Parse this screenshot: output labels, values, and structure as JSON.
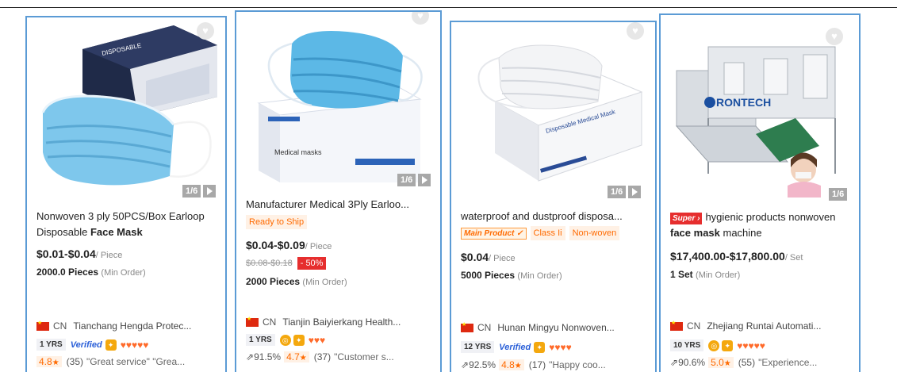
{
  "products": [
    {
      "title_pre": "Nonwoven 3 ply 50PCS/Box Earloop Disposable ",
      "title_bold": "Face Mask",
      "image_counter": "1/6",
      "price": "$0.01-$0.04",
      "unit": "/ Piece",
      "moq": "2000.0 Pieces",
      "min_order": "(Min Order)",
      "country": "CN",
      "supplier": "Tianchang Hengda Protec...",
      "years": "1 YRS",
      "verified": "Verified",
      "score": "4.8",
      "reviews": "(35)",
      "review_text": "\"Great service\"  \"Grea..."
    },
    {
      "title": "Manufacturer Medical 3Ply Earloo...",
      "tag": "Ready to Ship",
      "image_counter": "1/6",
      "price": "$0.04-$0.09",
      "unit": "/ Piece",
      "original_price": "$0.08-$0.18",
      "discount": "- 50%",
      "moq": "2000 Pieces",
      "min_order": "(Min Order)",
      "country": "CN",
      "supplier": "Tianjin Baiyierkang Health...",
      "years": "1 YRS",
      "response_rate": "91.5%",
      "score": "4.7",
      "reviews": "(37)",
      "review_text": "\"Customer s..."
    },
    {
      "title": "waterproof and dustproof disposa...",
      "main_product": "Main Product",
      "tags": [
        "Class Ii",
        "Non-woven"
      ],
      "image_counter": "1/6",
      "price": "$0.04",
      "unit": "/ Piece",
      "moq": "5000 Pieces",
      "min_order": "(Min Order)",
      "country": "CN",
      "supplier": "Hunan Mingyu Nonwoven...",
      "years": "12 YRS",
      "verified": "Verified",
      "response_rate": "92.5%",
      "score": "4.8",
      "reviews": "(17)",
      "review_text": "\"Happy coo..."
    },
    {
      "super": "Super",
      "title_pre": "hygienic products nonwoven ",
      "title_bold": "face mask",
      "title_post": " machine",
      "image_counter": "1/6",
      "image_brand": "RONTECH",
      "price": "$17,400.00-$17,800.00",
      "unit": "/ Set",
      "moq": "1 Set",
      "min_order": "(Min Order)",
      "country": "CN",
      "supplier": "Zhejiang Runtai Automati...",
      "years": "10 YRS",
      "response_rate": "90.6%",
      "score": "5.0",
      "reviews": "(55)",
      "review_text": "\"Experience..."
    }
  ],
  "colors": {
    "accent": "#ff6a00",
    "border": "#5b9bd5",
    "verified": "#2a5fd8",
    "discount": "#e62e2e"
  }
}
